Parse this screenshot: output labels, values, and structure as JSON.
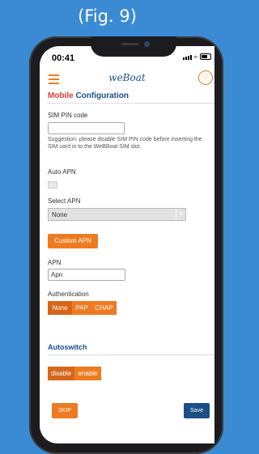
{
  "caption": "(Fig. 9)",
  "status_bar": {
    "time": "00:41"
  },
  "header": {
    "brand": "weBoat",
    "menu_icon": "hamburger-menu-icon",
    "bell_icon": "bell-icon"
  },
  "page": {
    "title_part1": "Mobile",
    "title_part2": "Configuration"
  },
  "sim_pin": {
    "label": "SIM PIN code",
    "value": "",
    "hint": "Suggestion: please disable SIM PIN code before inserting the SIM card in to the WeBBoat SIM slot."
  },
  "auto_apn": {
    "label": "Auto APN",
    "checked": false
  },
  "select_apn": {
    "label": "Select APN",
    "value": "None"
  },
  "custom_apn_button": "Custom APN",
  "apn": {
    "label": "APN",
    "value": "Apn"
  },
  "authentication": {
    "label": "Authentication",
    "options": [
      "None",
      "PAP",
      "CHAP"
    ],
    "selected": "None"
  },
  "autoswitch": {
    "title": "Autoswitch",
    "options": [
      "disable",
      "enable"
    ],
    "selected": "disable"
  },
  "actions": {
    "skip": "SKIP",
    "save": "Save"
  },
  "colors": {
    "accent": "#ee7b22",
    "brand_blue": "#1b4f86",
    "title_red": "#e03c31",
    "background": "#3a8bd3"
  }
}
